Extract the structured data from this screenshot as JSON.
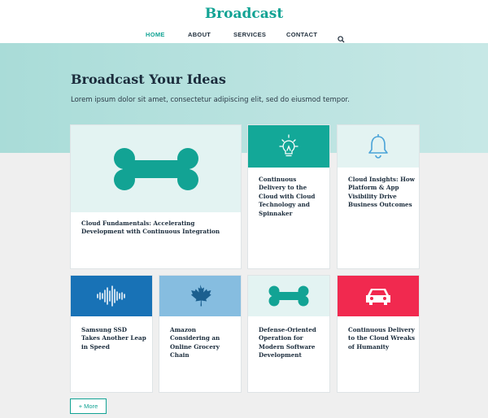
{
  "header": {
    "logo": "Broadcast",
    "nav": [
      {
        "label": "HOME",
        "active": true
      },
      {
        "label": "ABOUT",
        "active": false
      },
      {
        "label": "SERVICES",
        "active": false
      },
      {
        "label": "CONTACT",
        "active": false
      }
    ],
    "search_icon": "search-icon"
  },
  "hero": {
    "title": "Broadcast Your Ideas",
    "subtitle": "Lorem ipsum dolor sit amet, consectetur adipiscing elit, sed do eiusmod tempor."
  },
  "cards": [
    {
      "title": "Cloud Fundamentals: Accelerating Development with Continuous Integration",
      "icon": "bone-icon",
      "media_color": "#e3f3f2",
      "icon_color": "#12a394"
    },
    {
      "title": "Continuous Delivery to the Cloud with Cloud Technology and Spinnaker",
      "icon": "lightbulb-icon",
      "media_color": "#13a898",
      "icon_color": "#ffffff"
    },
    {
      "title": "Cloud Insights: How Platform & App Visibility Drive Business Outcomes",
      "icon": "bell-icon",
      "media_color": "#e3f3f2",
      "icon_color": "#4aa3d8"
    },
    {
      "title": "Samsung SSD Takes Another Leap in Speed",
      "icon": "soundwave-icon",
      "media_color": "#1872b6",
      "icon_color": "#ffffff"
    },
    {
      "title": "Amazon Considering an Online Grocery Chain",
      "icon": "maple-leaf-icon",
      "media_color": "#86bde0",
      "icon_color": "#1b5f8f"
    },
    {
      "title": "Defense-Oriented Operation for Modern Software Development",
      "icon": "bone-icon",
      "media_color": "#e3f3f2",
      "icon_color": "#12a394"
    },
    {
      "title": "Continuous Delivery to the Cloud Wreaks of Humanity",
      "icon": "car-icon",
      "media_color": "#f1294f",
      "icon_color": "#ffffff"
    }
  ],
  "more_button": "+ More"
}
